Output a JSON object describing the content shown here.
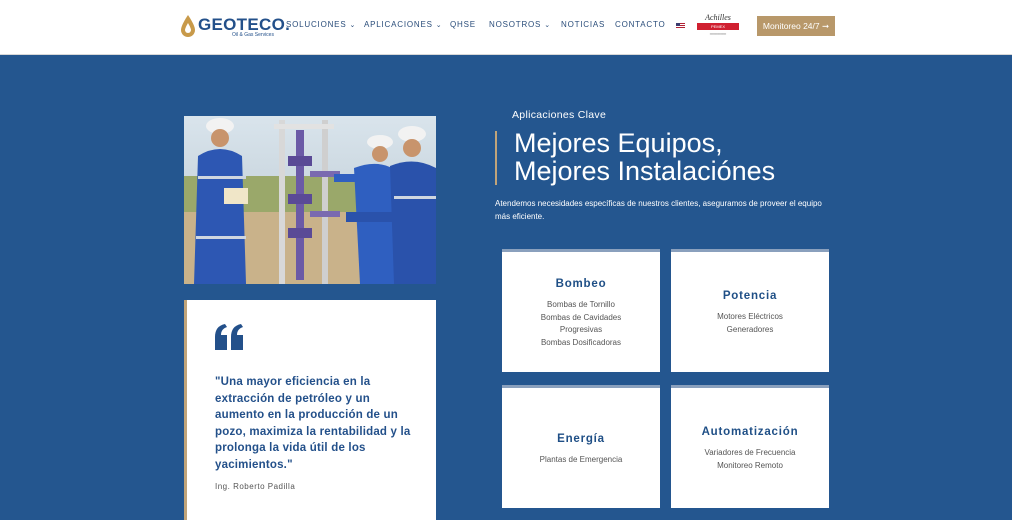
{
  "header": {
    "logo_text": "GEOTECO.",
    "logo_sub": "Oil & Gas Services",
    "nav": [
      {
        "label": "SOLUCIONES",
        "has_dropdown": true
      },
      {
        "label": "APLICACIONES",
        "has_dropdown": true
      },
      {
        "label": "QHSE",
        "has_dropdown": false
      },
      {
        "label": "NOSOTROS",
        "has_dropdown": true
      },
      {
        "label": "NOTICIAS",
        "has_dropdown": false
      },
      {
        "label": "CONTACTO",
        "has_dropdown": false
      }
    ],
    "chevron": "⌄",
    "cert_logo_title": "Achilles",
    "cert_logo_bar": "PEMEX",
    "cta_label": "Monitoreo 24/7 ➞"
  },
  "hero": {
    "eyebrow": "Aplicaciones Clave",
    "headline_line1": "Mejores Equipos,",
    "headline_line2": "Mejores Instalaciónes",
    "intro": "Atendemos necesidades específicas de nuestros clientes, aseguramos de proveer el equipo más eficiente."
  },
  "quote": {
    "text": "\"Una mayor eficiencia en la extracción de petróleo y un aumento en la producción de un pozo, maximiza la rentabilidad y la prolonga la vida útil de los yacimientos.\"",
    "author": "Ing. Roberto Padilla"
  },
  "cards": [
    {
      "title": "Bombeo",
      "lines": [
        "Bombas de Tornillo",
        "Bombas de Cavidades",
        "Progresivas",
        "Bombas Dosificadoras"
      ]
    },
    {
      "title": "Potencia",
      "lines": [
        "Motores Eléctricos",
        "Generadores"
      ]
    },
    {
      "title": "Energía",
      "lines": [
        "Plantas de Emergencia"
      ]
    },
    {
      "title": "Automatización",
      "lines": [
        "Variadores de Frecuencia",
        "Monitoreo Remoto"
      ]
    }
  ],
  "colors": {
    "background": "#24568f",
    "accent_gold": "#c0a47a",
    "cta": "#b8986a",
    "heading_blue": "#1f4f86"
  },
  "icons": [
    "geoteco-logo-icon",
    "usa-flag-icon",
    "quote-icon",
    "chevron-down-icon"
  ]
}
